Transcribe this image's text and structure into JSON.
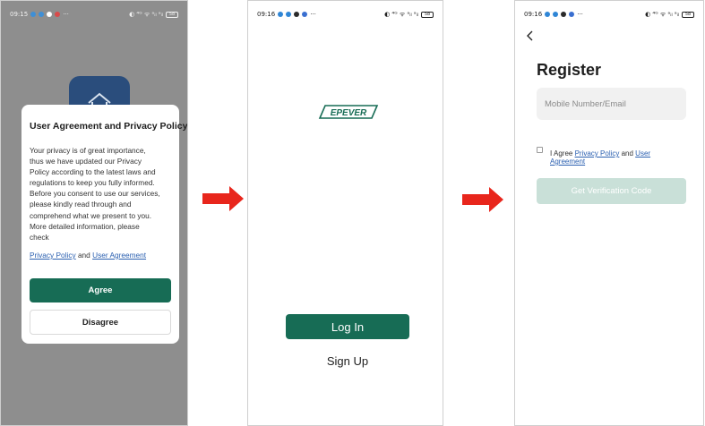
{
  "status_bars": {
    "p1": {
      "time": "09:15",
      "dots": [
        "#3f8fd6",
        "#3f8fd6",
        "#ffffff",
        "#d84b4b"
      ],
      "right": "◐ ⁴ᴳ ᯤ ᵃᵢₗ ᵃᵢₗ",
      "battery": "58"
    },
    "p2": {
      "time": "09:16",
      "dots": [
        "#2f86d6",
        "#2f86d6",
        "#2a2a2a",
        "#3a6fd0"
      ],
      "right": "◐ ⁴ᴳ ᯤ ᵃᵢₗ ᵃᵢₗ",
      "battery": "58"
    },
    "p3": {
      "time": "09:16",
      "dots": [
        "#2f86d6",
        "#2f86d6",
        "#2a2a2a",
        "#3a6fd0"
      ],
      "right": "◐ ⁴ᴳ ᯤ ᵃᵢₗ ᵃᵢₗ",
      "battery": "58"
    }
  },
  "privacy": {
    "title": "User Agreement and Privacy Policy",
    "body": "Your privacy is of great importance,\nthus we have updated our Privacy\nPolicy according to the latest laws and\nregulations to keep you fully informed.\nBefore you consent to use our services,\nplease kindly read through and\ncomprehend what we present to you.\n More detailed information, please\ncheck",
    "privacy_link": "Privacy Policy",
    "and_text": " and ",
    "agreement_link": "User Agreement",
    "agree_label": "Agree",
    "disagree_label": "Disagree"
  },
  "login": {
    "logo_text": "EPEVER",
    "login_label": "Log In",
    "signup_label": "Sign Up"
  },
  "register": {
    "back_icon": "chevron-left-icon",
    "title": "Register",
    "input_placeholder": "Mobile Number/Email",
    "agree_prefix": "I Agree ",
    "privacy_link": "Privacy Policy",
    "and_text": " and ",
    "agreement_link": "User Agreement",
    "code_button": "Get Verification Code"
  },
  "colors": {
    "primary": "#176c55",
    "primary_disabled": "#c9e0d8",
    "arrow": "#e8261c",
    "overlay": "#8e8e8e",
    "link": "#2a5fb0"
  }
}
